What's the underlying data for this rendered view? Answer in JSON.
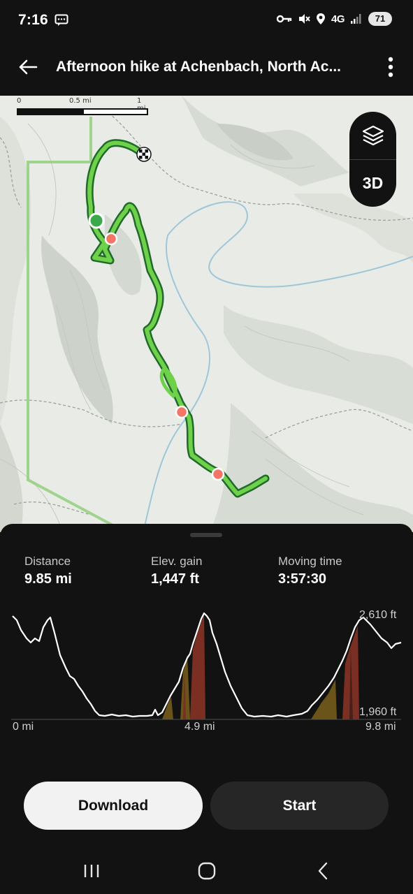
{
  "status": {
    "time": "7:16",
    "network": "4G",
    "battery": "71"
  },
  "appbar": {
    "title": "Afternoon hike at Achenbach, North Ac..."
  },
  "map": {
    "scale_labels": [
      "0",
      "0.5 mi",
      "1 mi"
    ],
    "control_3d_label": "3D",
    "route_color": "#6fd04a",
    "start_color": "#3aa94a",
    "waypoint_color": "#f27567"
  },
  "stats": [
    {
      "label": "Distance",
      "value": "9.85 mi"
    },
    {
      "label": "Elev. gain",
      "value": "1,447 ft"
    },
    {
      "label": "Moving time",
      "value": "3:57:30"
    }
  ],
  "elevation_chart": {
    "y_max_label": "2,610 ft",
    "y_min_label": "1,960 ft",
    "x_labels": [
      "0 mi",
      "4.9 mi",
      "9.8 mi"
    ]
  },
  "actions": {
    "download_label": "Download",
    "start_label": "Start"
  }
}
